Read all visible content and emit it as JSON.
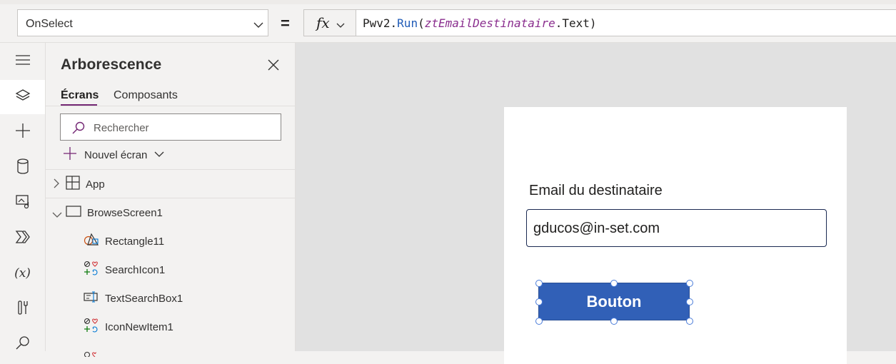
{
  "formula_bar": {
    "property": "OnSelect",
    "equals": "=",
    "fx_label": "fx",
    "formula": {
      "object": "Pwv2",
      "dot1": ".",
      "function": "Run",
      "open_paren": "(",
      "control": "ztEmailDestinataire",
      "dot2": ".",
      "property": "Text",
      "close_paren": ")"
    }
  },
  "rail": {
    "icons": [
      "hamburger-icon",
      "layers-icon",
      "plus-icon",
      "database-icon",
      "media-icon",
      "power-automate-icon",
      "variables-icon",
      "tools-icon",
      "search-icon"
    ],
    "variables_label": "(x)"
  },
  "tree": {
    "title": "Arborescence",
    "tabs": [
      {
        "label": "Écrans",
        "active": true
      },
      {
        "label": "Composants",
        "active": false
      }
    ],
    "search_placeholder": "Rechercher",
    "new_screen_label": "Nouvel écran",
    "items": [
      {
        "label": "App",
        "icon": "app-grid-icon"
      },
      {
        "label": "BrowseScreen1",
        "icon": "screen-icon"
      },
      {
        "label": "Rectangle11",
        "icon": "shapes-icon"
      },
      {
        "label": "SearchIcon1",
        "icon": "icons-icon"
      },
      {
        "label": "TextSearchBox1",
        "icon": "text-input-icon"
      },
      {
        "label": "IconNewItem1",
        "icon": "icons-icon"
      }
    ]
  },
  "canvas": {
    "email_label": "Email du destinataire",
    "email_value": "gducos@in-set.com",
    "button_label": "Bouton"
  },
  "colors": {
    "accent_purple": "#742774",
    "button_blue": "#3160b7",
    "canvas_bg": "#e1e1e1"
  }
}
